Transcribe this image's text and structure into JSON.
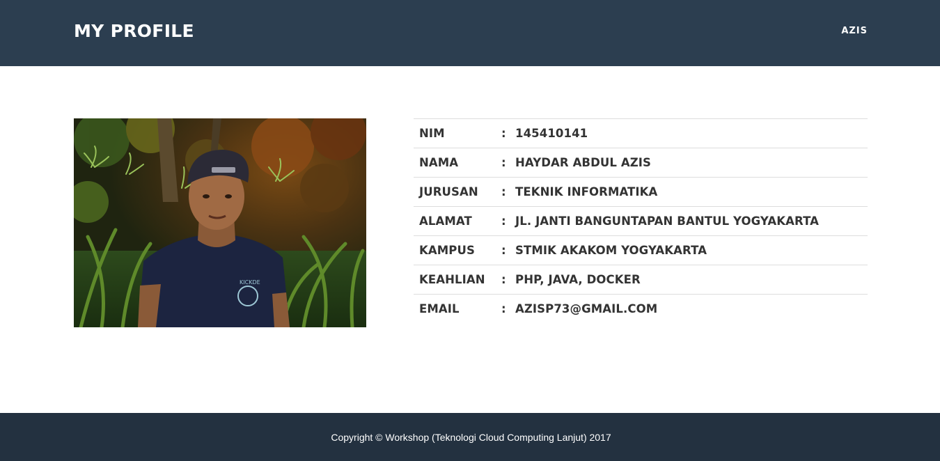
{
  "navbar": {
    "brand": "MY PROFILE",
    "link": "AZIS"
  },
  "photo": {
    "shirt_text": "KICKDE"
  },
  "profile": {
    "rows": [
      {
        "label": "NIM",
        "sep": ":",
        "value": "145410141"
      },
      {
        "label": "NAMA",
        "sep": ":",
        "value": "HAYDAR ABDUL AZIS"
      },
      {
        "label": "JURUSAN",
        "sep": ":",
        "value": "TEKNIK INFORMATIKA"
      },
      {
        "label": "ALAMAT",
        "sep": ":",
        "value": "JL. JANTI BANGUNTAPAN BANTUL YOGYAKARTA"
      },
      {
        "label": "KAMPUS",
        "sep": ":",
        "value": "STMIK AKAKOM YOGYAKARTA"
      },
      {
        "label": "KEAHLIAN",
        "sep": ":",
        "value": "PHP, JAVA, DOCKER"
      },
      {
        "label": "EMAIL",
        "sep": ":",
        "value": "AZISP73@GMAIL.COM"
      }
    ]
  },
  "footer": {
    "copyright": "Copyright © Workshop (Teknologi Cloud Computing Lanjut) 2017"
  },
  "colors": {
    "navbar_bg": "#2c3e50",
    "footer_bg": "#233140",
    "text": "#333333",
    "divider": "#dddddd"
  }
}
